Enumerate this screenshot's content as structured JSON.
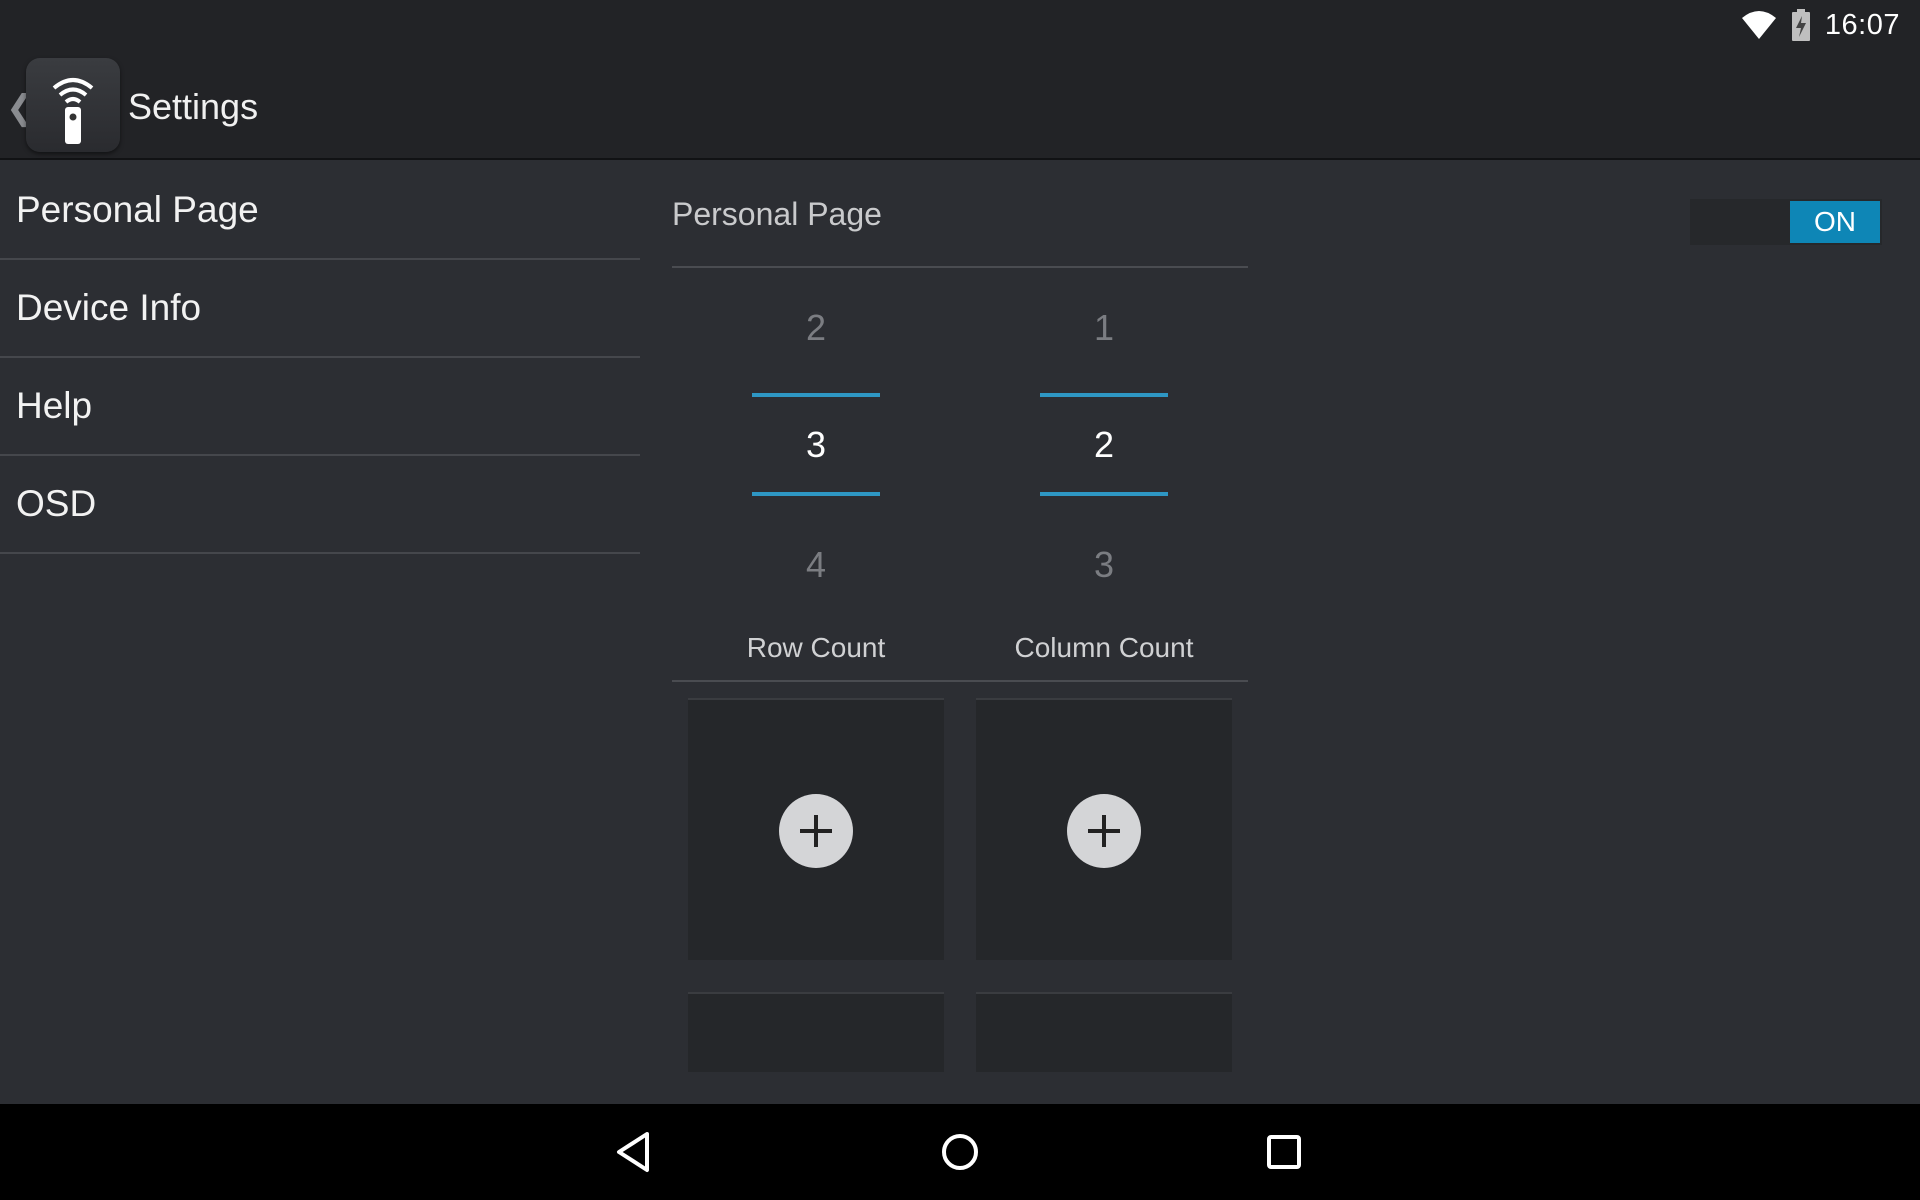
{
  "status_bar": {
    "time": "16:07",
    "icons": [
      "wifi-icon",
      "battery-charging-icon"
    ]
  },
  "action_bar": {
    "title": "Settings",
    "app_icon": "remote-wifi-icon"
  },
  "nav": {
    "items": [
      {
        "label": "Personal Page"
      },
      {
        "label": "Device Info"
      },
      {
        "label": "Help"
      },
      {
        "label": "OSD"
      }
    ]
  },
  "panel": {
    "title": "Personal Page",
    "toggle_label": "ON",
    "row_picker": {
      "prev": "2",
      "selected": "3",
      "next": "4",
      "label": "Row Count"
    },
    "column_picker": {
      "prev": "1",
      "selected": "2",
      "next": "3",
      "label": "Column Count"
    }
  },
  "colors": {
    "accent": "#0e86b6",
    "background": "#2c2e33",
    "bar": "#222326"
  },
  "system_nav": [
    "back-icon",
    "home-icon",
    "recents-icon"
  ]
}
